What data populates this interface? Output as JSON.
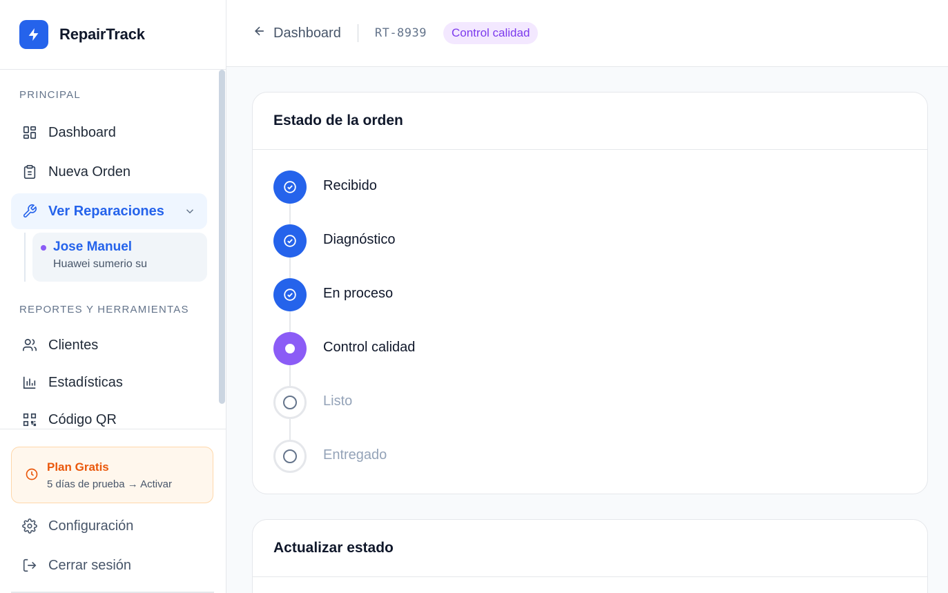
{
  "app": {
    "name": "RepairTrack"
  },
  "sidebar": {
    "section_principal": "PRINCIPAL",
    "section_reportes": "REPORTES Y HERRAMIENTAS",
    "items": [
      {
        "label": "Dashboard"
      },
      {
        "label": "Nueva Orden"
      },
      {
        "label": "Ver Reparaciones"
      },
      {
        "label": "Clientes"
      },
      {
        "label": "Estadísticas"
      },
      {
        "label": "Código QR"
      }
    ],
    "sub_item": {
      "title": "Jose Manuel",
      "desc": "Huawei sumerio su"
    },
    "plan": {
      "title": "Plan Gratis",
      "desc": "5 días de prueba → Activar"
    },
    "bottom": [
      {
        "label": "Configuración"
      },
      {
        "label": "Cerrar sesión"
      }
    ]
  },
  "topbar": {
    "back_label": "Dashboard",
    "order_id": "RT-8939",
    "status": "Control calidad",
    "status_color": "#7c3aed"
  },
  "status_card": {
    "title": "Estado de la orden",
    "steps": [
      {
        "label": "Recibido",
        "state": "done"
      },
      {
        "label": "Diagnóstico",
        "state": "done"
      },
      {
        "label": "En proceso",
        "state": "done"
      },
      {
        "label": "Control calidad",
        "state": "current"
      },
      {
        "label": "Listo",
        "state": "pending"
      },
      {
        "label": "Entregado",
        "state": "pending"
      }
    ]
  },
  "update_card": {
    "title": "Actualizar estado"
  },
  "colors": {
    "primary": "#2563eb",
    "current": "#8b5cf6",
    "plan": "#ea580c"
  }
}
